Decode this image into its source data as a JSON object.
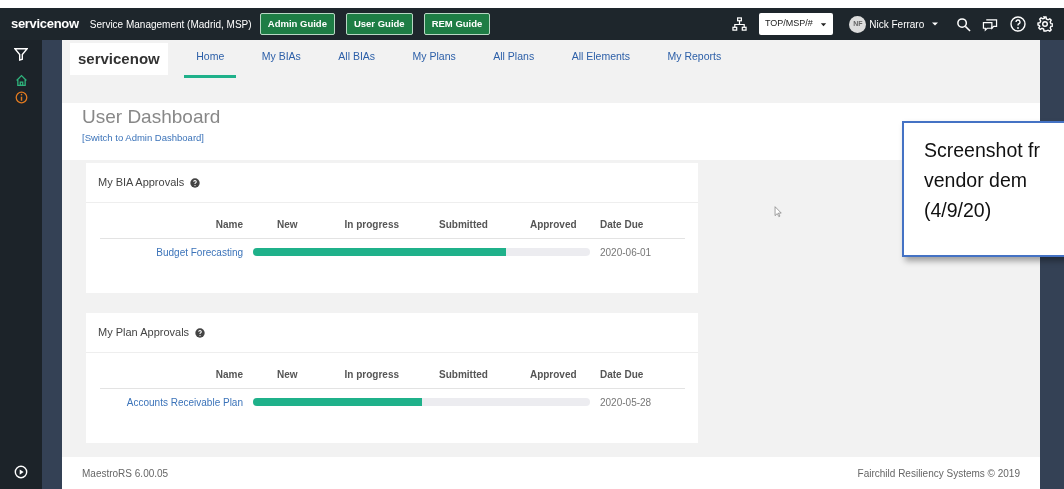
{
  "topbar": {
    "brand": "servicenow",
    "instance": "Service Management (Madrid, MSP)",
    "guides": [
      "Admin Guide",
      "User Guide",
      "REM Guide"
    ],
    "domain_select": "TOP/MSP/#",
    "user": {
      "initials": "NF",
      "name": "Nick Ferraro"
    }
  },
  "sidebar": {
    "items": [
      {
        "kind": "filter",
        "selected": false
      },
      {
        "kind": "home",
        "selected": true
      },
      {
        "kind": "info",
        "selected": false
      }
    ]
  },
  "nav": {
    "logo": "servicenow",
    "tabs": [
      {
        "label": "Home",
        "selected": true
      },
      {
        "label": "My BIAs",
        "selected": false
      },
      {
        "label": "All BIAs",
        "selected": false
      },
      {
        "label": "My Plans",
        "selected": false
      },
      {
        "label": "All Plans",
        "selected": false
      },
      {
        "label": "All Elements",
        "selected": false
      },
      {
        "label": "My Reports",
        "selected": false
      }
    ]
  },
  "dashboard": {
    "title": "User Dashboard",
    "switch_link": "[Switch to Admin Dashboard]"
  },
  "cards": [
    {
      "title": "My BIA Approvals",
      "columns": [
        "Name",
        "New",
        "In progress",
        "Submitted",
        "Approved",
        "Date Due"
      ],
      "rows": [
        {
          "name": "Budget Forecasting",
          "level": 0.75,
          "date_due": "2020-06-01"
        }
      ]
    },
    {
      "title": "My Plan Approvals",
      "columns": [
        "Name",
        "New",
        "In progress",
        "Submitted",
        "Approved",
        "Date Due"
      ],
      "rows": [
        {
          "name": "Accounts Receivable Plan",
          "level": 0.5,
          "date_due": "2020-05-28"
        }
      ]
    }
  ],
  "footer": {
    "version": "MaestroRS 6.00.05",
    "copyright": "Fairchild Resiliency Systems © 2019"
  },
  "callout": {
    "lines": [
      "Screenshot fr",
      "vendor dem",
      "(4/9/20)"
    ]
  }
}
